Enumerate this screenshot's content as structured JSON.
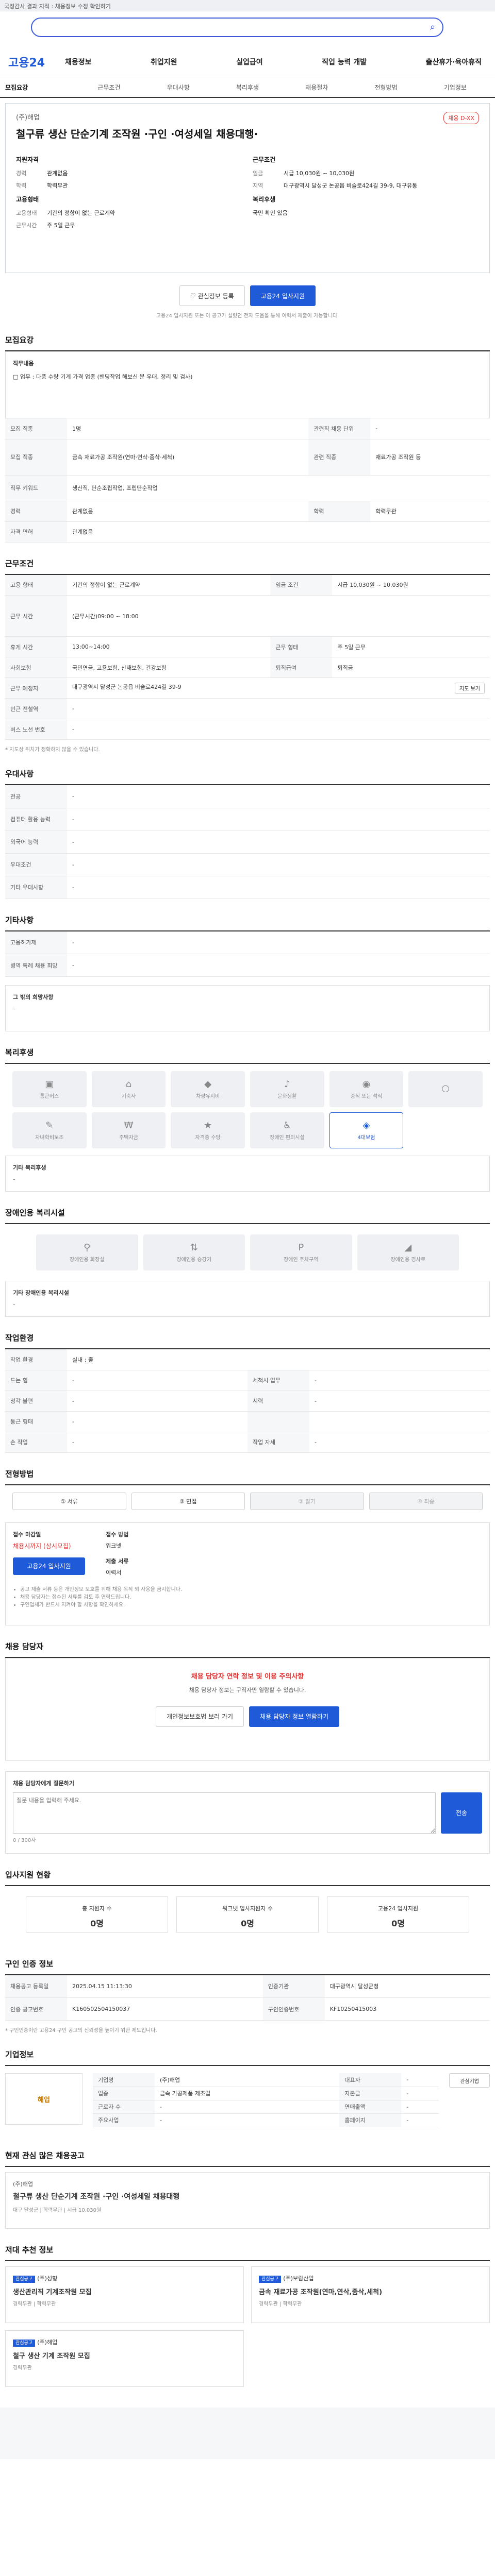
{
  "topbar": {
    "text": "국정감사 결과 지적 : 채용정보 수정 확인하기",
    "close": "닫기"
  },
  "logo": "고용24",
  "gnb": [
    "채용정보",
    "취업지원",
    "실업급여",
    "직업 능력 개발",
    "출산휴가·육아휴직"
  ],
  "tabs": [
    "모집요강",
    "근무조건",
    "우대사항",
    "복리후생",
    "채용절차",
    "전형방법",
    "기업정보"
  ],
  "job": {
    "company": "(주)해업",
    "title": "철구류 생산 단순기계 조작원 ·구인 ·여성세일 채용대행·",
    "badge": "채용 D-XX",
    "apply_label": "지원자격",
    "work_label": "근무조건",
    "career_k": "경력",
    "career_v": "관계없음",
    "edu_k": "학력",
    "edu_v": "학력무관",
    "salary_k": "임금",
    "salary_v": "시급 10,030원 ~ 10,030원",
    "region_k": "지역",
    "region_v": "대구광역시 달성군 논공읍 비슬로424길 39-9, 대구유통",
    "emp_label": "고용형태",
    "emp_k": "고용형태",
    "emp_v": "기간의 정함이 없는 근로계약",
    "hours_k": "근무시간",
    "hours_v": "주 5일 근무",
    "welfare_label": "복리후생",
    "welfare_v": "국민 확인 있음",
    "fav_button": "관심정보 등록",
    "apply_button": "고용24 입사지원",
    "note": "고용24 입사지원 또는 이 공고가 실렸던 전자 도움을 통해 이력서 제출이 가능합니다."
  },
  "recruit": {
    "title": "모집요강",
    "duty_label": "직무내용",
    "duty": "□ 업무 : 다품 수량 기계 가격 업종 (밴딩작업 해보신 분 우대, 정리 및 검사)",
    "rows": [
      {
        "k": "모집 직종",
        "v": "1명",
        "k2": "관련직 채용 단위",
        "v2": "-"
      },
      {
        "k": "모집 직종",
        "v": "금속 재료가공 조작원(연마·연삭·줌삭·세척)",
        "k2": "관련 직종",
        "v2": "재료가공 조작원 등"
      },
      {
        "k": "직무 키워드",
        "v": "생산직, 단순조립작업, 조립단순작업",
        "k2": "",
        "v2": ""
      },
      {
        "k": "경력",
        "v": "관계없음",
        "k2": "학력",
        "v2": "학력무관"
      },
      {
        "k": "자격 면허",
        "v": "관계없음",
        "k2": "",
        "v2": ""
      }
    ]
  },
  "conditions": {
    "title": "근무조건",
    "rows": [
      {
        "k": "고용 형태",
        "v": "기간의 정함이 없는 근로계약",
        "k2": "임금 조건",
        "v2": "시급 10,030원 ~ 10,030원"
      },
      {
        "k": "근무 시간",
        "v": "(근무시간)09:00 ~ 18:00",
        "k2": "",
        "v2": ""
      },
      {
        "k": "휴게 시간",
        "v": "13:00~14:00",
        "k2": "근무 형태",
        "v2": "주 5일 근무"
      },
      {
        "k": "사회보험",
        "v": "국민연금, 고용보험, 산재보험, 건강보험",
        "k2": "퇴직급여",
        "v2": "퇴직금"
      },
      {
        "k": "근무 예정지",
        "v": "대구광역시 달성군 논공읍 비슬로424길 39-9",
        "k2": "",
        "v2": ""
      },
      {
        "k": "인근 전철역",
        "v": "-",
        "k2": "",
        "v2": ""
      },
      {
        "k": "버스 노선 번호",
        "v": "-",
        "k2": "",
        "v2": ""
      }
    ],
    "map_button": "지도 보기",
    "footnote": "* 지도상 위치가 정확하지 않을 수 있습니다."
  },
  "prefer": {
    "title": "우대사항",
    "rows": [
      {
        "k": "전공",
        "v": "-"
      },
      {
        "k": "컴퓨터 활용 능력",
        "v": "-"
      },
      {
        "k": "외국어 능력",
        "v": "-"
      },
      {
        "k": "우대조건",
        "v": "-"
      },
      {
        "k": "기타 우대사항",
        "v": "-"
      }
    ]
  },
  "others": {
    "title": "기타사항",
    "rows": [
      {
        "k": "고용허가제",
        "v": "-"
      },
      {
        "k": "병역 특례 채용 희망",
        "v": "-"
      }
    ]
  },
  "disabled": {
    "title": "그 밖의 희망사항",
    "v": "-"
  },
  "welfare": {
    "title": "복리후생",
    "items": [
      {
        "label": "통근버스",
        "icon": "bus-icon",
        "on": false
      },
      {
        "label": "기숙사",
        "icon": "house-icon",
        "on": false
      },
      {
        "label": "차량유지비",
        "icon": "car-icon",
        "on": false
      },
      {
        "label": "문화생활",
        "icon": "ticket-icon",
        "on": false
      },
      {
        "label": "중식 또는 석식",
        "icon": "meal-icon",
        "on": false
      },
      {
        "label": "",
        "icon": "blank-icon",
        "on": false
      },
      {
        "label": "자녀학비보조",
        "icon": "school-icon",
        "on": false
      },
      {
        "label": "주택자금",
        "icon": "money-icon",
        "on": false
      },
      {
        "label": "자격증 수당",
        "icon": "badge-icon",
        "on": false
      },
      {
        "label": "장애인 편의시설",
        "icon": "wheelchair-icon",
        "on": false
      },
      {
        "label": "4대보험",
        "icon": "shield-icon",
        "on": true
      }
    ],
    "etc_label": "기타 복리후생",
    "etc_v": "-"
  },
  "facility": {
    "title": "장애인용 복리시설",
    "items": [
      "장애인용 화장실",
      "장애인용 승강기",
      "장애인 주차구역",
      "장애인용 경사로"
    ],
    "etc_label": "기타 장애인용 복리시설",
    "etc_v": "-"
  },
  "workenv": {
    "title": "작업환경",
    "rows": [
      {
        "k": "작업 환경",
        "v": "실내 : 좋"
      },
      {
        "k": "드는 힘",
        "v": "-",
        "k2": "세척시 업무",
        "v2": "-"
      },
      {
        "k": "청각 불편",
        "v": "-",
        "k2": "시력",
        "v2": "-"
      },
      {
        "k": "통근 형태",
        "v": "-",
        "k2": "",
        "v2": ""
      },
      {
        "k": "손 작업",
        "v": "-",
        "k2": "작업 자세",
        "v2": "-"
      }
    ]
  },
  "process": {
    "title": "전형방법",
    "steps": [
      "① 서류",
      "② 면접",
      "③ 필기",
      "④ 최종"
    ]
  },
  "apply": {
    "receipt_label": "접수 마감일",
    "receipt_v": "채용시까지 (상시모집)",
    "method_label": "접수 방법",
    "method_v": "워크넷",
    "apply_button": "고용24 입사지원",
    "docs_label": "제출 서류",
    "docs_v": "이력서",
    "notes": [
      "공고 제출 서류 등은 개인정보 보호를 위해 채용 목적 외 사용을 금지합니다.",
      "채용 담당자는 접수된 서류를 검토 후 연락드립니다.",
      "구인업체가 반드시 지켜야 할 사항을 확인하세요."
    ]
  },
  "manager": {
    "title": "채용 담당자",
    "notice_red": "채용 담당자 연락 정보 및 이용 주의사항",
    "notice": "채용 담당자 정보는 구직자만 열람할 수 있습니다.",
    "btn1": "개인정보보호법 보러 가기",
    "btn2": "채용 담당자 정보 열람하기"
  },
  "qna": {
    "title": "채용 담당자에게 질문하기",
    "placeholder": "질문 내용을 입력해 주세요.",
    "count": "0 / 300자",
    "submit": "전송"
  },
  "status": {
    "title": "입사지원 현황",
    "more": "더보기",
    "cards": [
      {
        "label": "총 지원자 수",
        "v": "0명"
      },
      {
        "label": "워크넷 입사지원자 수",
        "v": "0명"
      },
      {
        "label": "고용24 입사지원",
        "v": "0명"
      }
    ]
  },
  "info": {
    "title": "구인 인증 정보",
    "rows": [
      {
        "k": "채용공고 등록일",
        "v": "2025.04.15 11:13:30",
        "k2": "인증기관",
        "v2": "대구광역시 달성군청"
      },
      {
        "k": "인증 공고번호",
        "v": "K160502504150037",
        "k2": "구인인증번호",
        "v2": "KF10250415003"
      }
    ],
    "note": "* 구인인증이란 고용24 구인 공고의 신뢰성을 높이기 위한 제도입니다."
  },
  "company": {
    "title": "기업정보",
    "name": "해업",
    "rows": [
      {
        "k": "기업명",
        "v": "(주)해업",
        "k2": "대표자",
        "v2": "-"
      },
      {
        "k": "업종",
        "v": "금속 가공제품 제조업",
        "k2": "자본금",
        "v2": "-"
      },
      {
        "k": "근로자 수",
        "v": "-",
        "k2": "연매출액",
        "v2": "-"
      },
      {
        "k": "주요사업",
        "v": "-",
        "k2": "홈페이지",
        "v2": "-"
      }
    ],
    "btn": "관심기업"
  },
  "similar": {
    "title": "현재 관심 많은 채용공고",
    "more": "더보기",
    "item_co": "(주)해업",
    "item_title": "철구류 생산 단순기계 조작원 ·구인 ·여성세일 채용대행",
    "item_meta": "대구 달성군 | 학력무관 | 시급 10,030원"
  },
  "recommend": {
    "title": "저대 추천 정보",
    "cards": [
      {
        "tag": "관심공고",
        "co": "(주)성형",
        "title": "생산관리직 기계조작원 모집",
        "meta": "경력무관 | 학력무관"
      },
      {
        "tag": "관심공고",
        "co": "(주)보람산업",
        "title": "금속 재료가공 조작원(연마,연삭,줌삭,세척)",
        "meta": "경력무관 | 학력무관"
      },
      {
        "tag": "관심공고",
        "co": "(주)해업",
        "title": "철구 생산 기계 조작원 모집",
        "meta": "경력무관"
      }
    ]
  }
}
